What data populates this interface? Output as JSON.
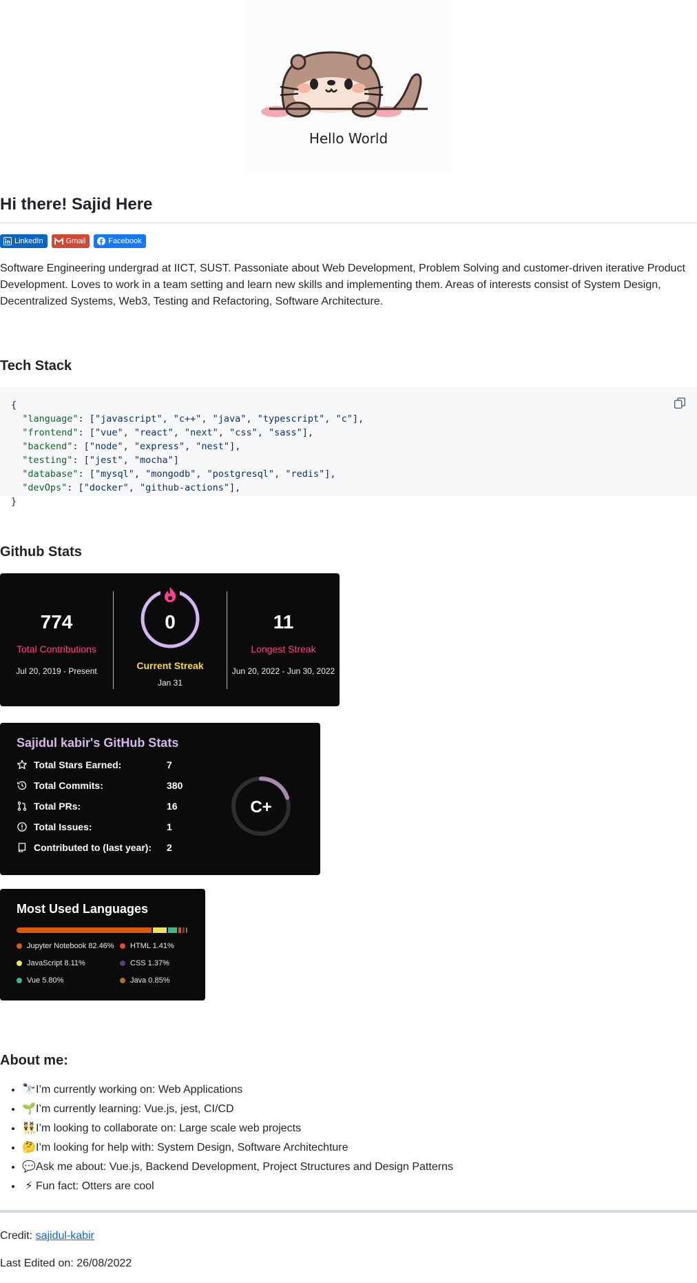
{
  "hero": {
    "caption": "Hello World"
  },
  "header": {
    "title": "Hi there! Sajid Here"
  },
  "badges": [
    {
      "label": "LinkedIn",
      "icon": "linkedin-icon",
      "color": "#0A66C2"
    },
    {
      "label": "Gmail",
      "icon": "gmail-icon",
      "color": "#D14836"
    },
    {
      "label": "Facebook",
      "icon": "facebook-icon",
      "color": "#1877F2"
    }
  ],
  "bio": "Software Engineering undergrad at IICT, SUST. Passoniate about Web Development, Problem Solving and customer-driven iterative Product Development. Loves to work in a team setting and learn new skills and implementing them. Areas of interests consist of System Design, Decentralized Systems, Web3, Testing and Refactoring, Software Architecture.",
  "tech_stack": {
    "title": "Tech Stack",
    "code_lines": [
      "{",
      "  \"language\": [\"javascript\", \"c++\", \"java\", \"typescript\", \"c\"],",
      "  \"frontend\": [\"vue\", \"react\", \"next\", \"css\", \"sass\"],",
      "  \"backend\": [\"node\", \"express\", \"nest\"],",
      "  \"testing\": [\"jest\", \"mocha\"]",
      "  \"database\": [\"mysql\", \"mongodb\", \"postgresql\", \"redis\"],",
      "  \"devOps\": [\"docker\", \"github-actions\"],",
      "}"
    ]
  },
  "github_stats": {
    "title": "Github Stats",
    "streak": {
      "total": {
        "value": "774",
        "label": "Total Contributions",
        "dates": "Jul 20, 2019 - Present"
      },
      "current": {
        "value": "0",
        "label": "Current Streak",
        "dates": "Jan 31"
      },
      "longest": {
        "value": "11",
        "label": "Longest Streak",
        "dates": "Jun 20, 2022 - Jun 30, 2022"
      },
      "colors": {
        "accent": "#fe428e",
        "current": "#f8d847",
        "ring": "#d3b5f0"
      }
    },
    "stats_card": {
      "title": "Sajidul kabir's GitHub Stats",
      "rows": [
        {
          "icon": "star-icon",
          "label": "Total Stars Earned:",
          "value": "7"
        },
        {
          "icon": "history-icon",
          "label": "Total Commits:",
          "value": "380"
        },
        {
          "icon": "pull-request-icon",
          "label": "Total PRs:",
          "value": "16"
        },
        {
          "icon": "issue-icon",
          "label": "Total Issues:",
          "value": "1"
        },
        {
          "icon": "repo-icon",
          "label": "Contributed to (last year):",
          "value": "2"
        }
      ],
      "rank": "C+",
      "rank_progress": 0.2
    },
    "languages": {
      "title": "Most Used Languages",
      "items": [
        {
          "name": "Jupyter Notebook",
          "percent": 82.46,
          "text": "Jupyter Notebook 82.46%",
          "color": "#DA5B0B"
        },
        {
          "name": "JavaScript",
          "percent": 8.11,
          "text": "JavaScript 8.11%",
          "color": "#f1e05a"
        },
        {
          "name": "Vue",
          "percent": 5.8,
          "text": "Vue 5.80%",
          "color": "#41b883"
        },
        {
          "name": "HTML",
          "percent": 1.41,
          "text": "HTML 1.41%",
          "color": "#e34c26"
        },
        {
          "name": "CSS",
          "percent": 1.37,
          "text": "CSS 1.37%",
          "color": "#563d7c"
        },
        {
          "name": "Java",
          "percent": 0.85,
          "text": "Java 0.85%",
          "color": "#b07219"
        }
      ]
    }
  },
  "about": {
    "title": "About me:",
    "items": [
      {
        "emoji": "🔭",
        "text": "I’m currently working on: Web Applications"
      },
      {
        "emoji": "🌱",
        "text": "I’m currently learning: Vue.js, jest, CI/CD"
      },
      {
        "emoji": "👯",
        "text": "I’m looking to collaborate on: Large scale web projects"
      },
      {
        "emoji": "🤔",
        "text": "I’m looking for help with: System Design, Software Architechture"
      },
      {
        "emoji": "💬",
        "text": "Ask me about: Vue.js, Backend Development, Project Structures and Design Patterns"
      },
      {
        "emoji": "⚡",
        "text": "Fun fact: Otters are cool"
      }
    ]
  },
  "footer": {
    "credit_label": "Credit: ",
    "credit_link": "sajidul-kabir",
    "edited": "Last Edited on: 26/08/2022"
  }
}
